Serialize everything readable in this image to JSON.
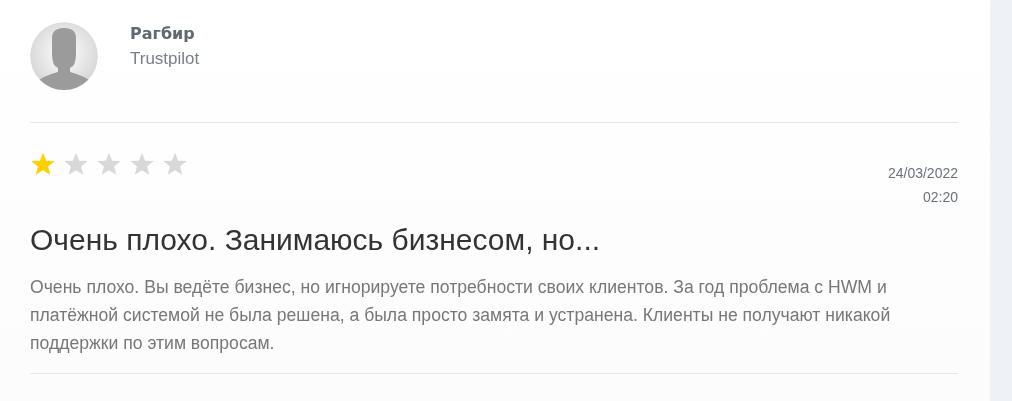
{
  "review": {
    "author": "Рагбир",
    "source": "Trustpilot",
    "stars": 1,
    "date": "24/03/2022",
    "time": "02:20",
    "title": "Очень плохо. Занимаюсь бизнесом, но...",
    "text": "Очень плохо. Вы ведёте бизнес, но игнорируете потребности своих клиентов. За год проблема с HWM и платёжной системой не была решена, а была просто замята и устранена. Клиенты не получают никакой поддержки по этим вопросам."
  }
}
